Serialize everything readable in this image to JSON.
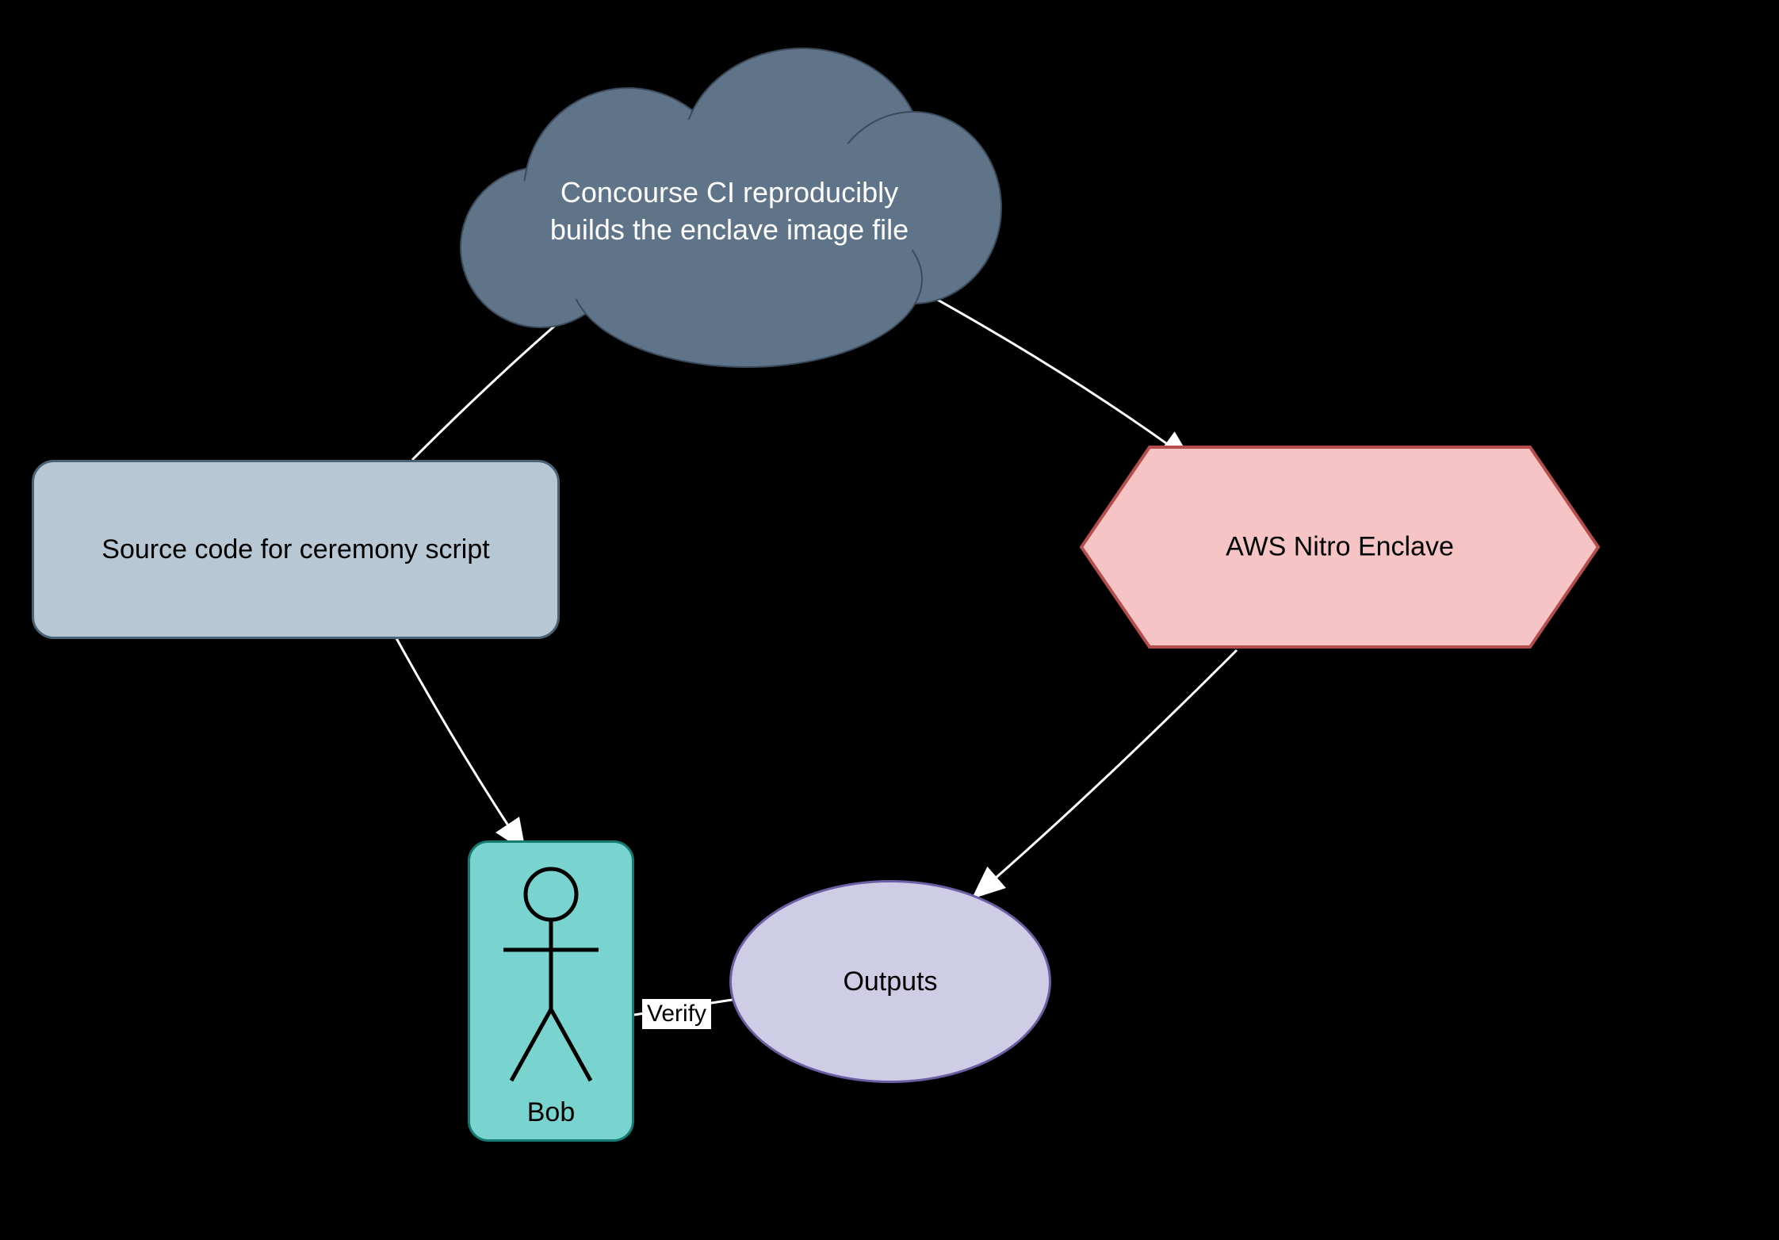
{
  "diagram": {
    "cloud_label_line1": "Concourse CI reproducibly",
    "cloud_label_line2": "builds the enclave image file",
    "source_code_label": "Source code for ceremony script",
    "enclave_label": "AWS Nitro Enclave",
    "actor_name": "Bob",
    "verify_label": "Verify",
    "outputs_label": "Outputs",
    "edges": {
      "source_to_cloud": "",
      "cloud_to_enclave": "",
      "source_to_bob_note": "",
      "enclave_to_outputs": ""
    }
  }
}
